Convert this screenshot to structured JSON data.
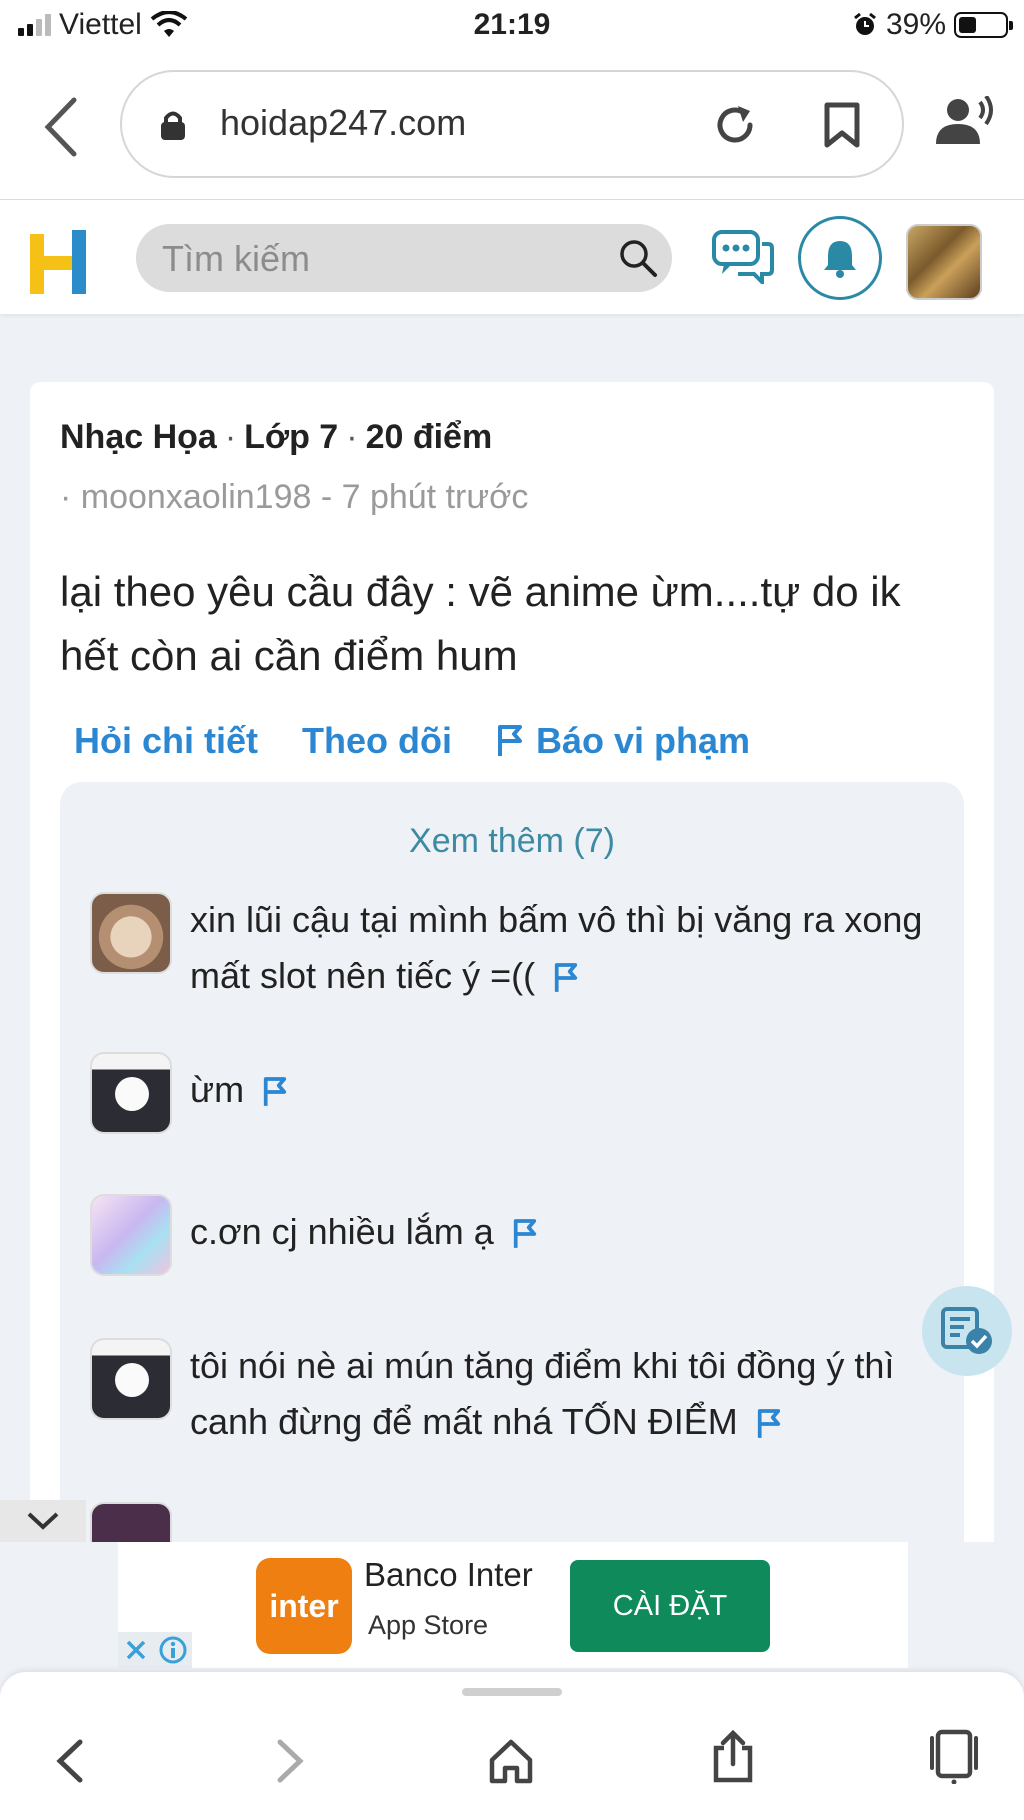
{
  "status": {
    "carrier": "Viettel",
    "time": "21:19",
    "battery": "39%",
    "battery_level": 0.39
  },
  "browser": {
    "url": "hoidap247.com"
  },
  "site": {
    "search_placeholder": "Tìm kiếm"
  },
  "question": {
    "subject": "Nhạc Họa",
    "grade": "Lớp 7",
    "points": "20 điểm",
    "author_line": "· moonxaolin198 - 7 phút trước",
    "body": "lại theo yêu cầu đây : vẽ anime ừm....tự do ik hết còn ai cần điểm hum",
    "actions": {
      "detail": "Hỏi chi tiết",
      "follow": "Theo dõi",
      "report": "Báo vi phạm"
    }
  },
  "comments": {
    "more": "Xem thêm (7)",
    "items": [
      {
        "text": "xin lũi cậu tại mình bấm vô thì bị văng ra xong mất slot nên tiếc ý =(("
      },
      {
        "text": "ừm"
      },
      {
        "text": "c.ơn cj nhiều lắm ạ"
      },
      {
        "text": "tôi nói nè ai mún tăng điểm khi tôi đồng ý thì canh đừng để mất nhá TỐN ĐIỂM"
      }
    ]
  },
  "ad": {
    "brand_logo": "inter",
    "name": "Banco Inter",
    "store": "App Store",
    "install": "CÀI ĐẶT"
  }
}
